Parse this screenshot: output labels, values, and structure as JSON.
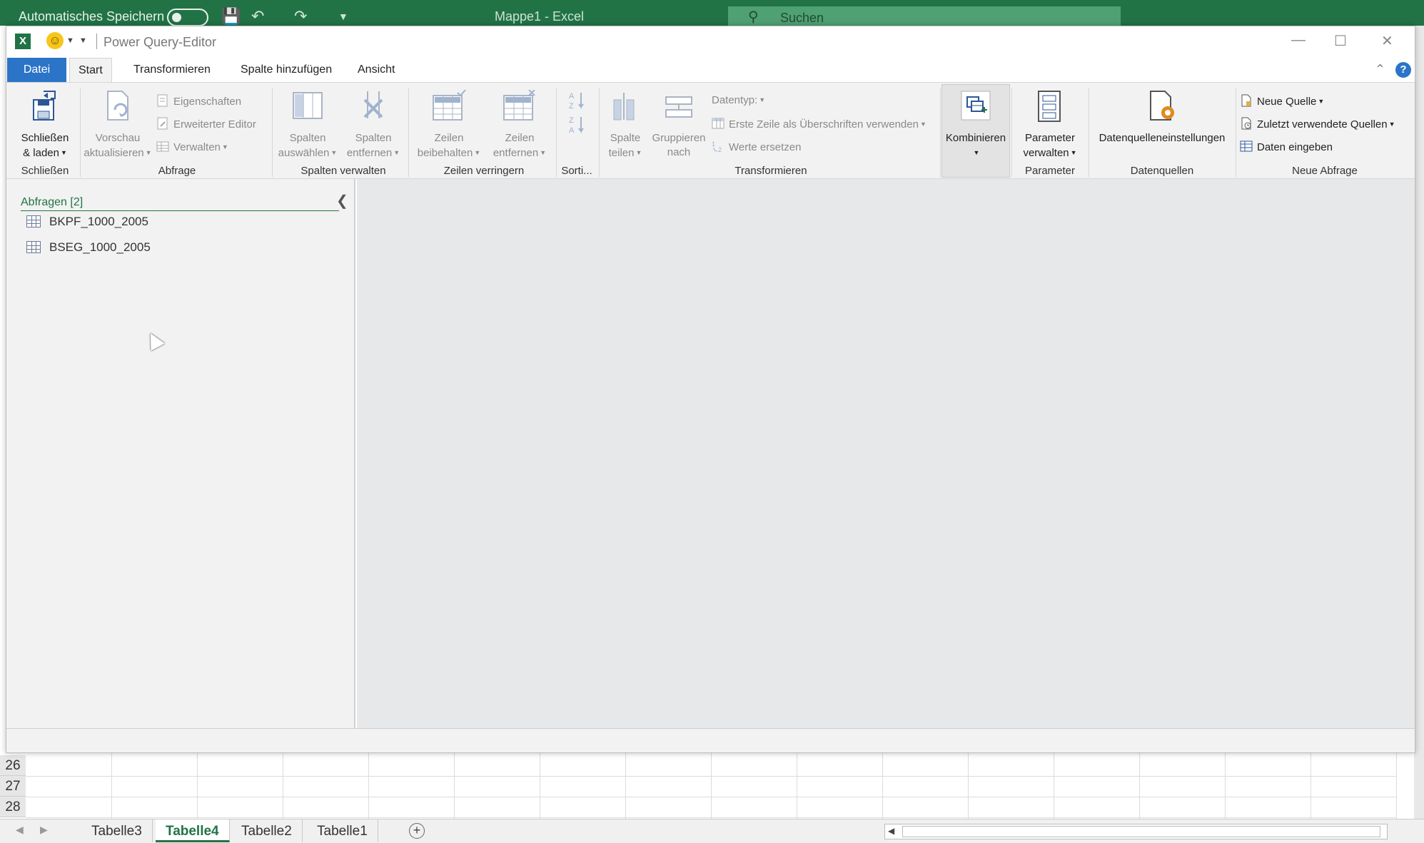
{
  "excel": {
    "autosave_label": "Automatisches Speichern",
    "document_title": "Mappe1  -  Excel",
    "search_placeholder": "Suchen",
    "row_numbers": [
      "26",
      "27",
      "28"
    ],
    "sheets": [
      "Tabelle3",
      "Tabelle4",
      "Tabelle2",
      "Tabelle1"
    ],
    "active_sheet": "Tabelle4"
  },
  "pq": {
    "title": "Power Query-Editor",
    "tabs": [
      "Datei",
      "Start",
      "Transformieren",
      "Spalte hinzufügen",
      "Ansicht"
    ],
    "active_tab": "Start"
  },
  "ribbon": {
    "schliessen": {
      "btn_line1": "Schließen",
      "btn_line2": "& laden",
      "group": "Schließen"
    },
    "abfrage": {
      "vorschau_line1": "Vorschau",
      "vorschau_line2": "aktualisieren",
      "eigenschaften": "Eigenschaften",
      "erweiterter_editor": "Erweiterter Editor",
      "verwalten": "Verwalten",
      "group": "Abfrage"
    },
    "spalten_verwalten": {
      "auswaehlen_line1": "Spalten",
      "auswaehlen_line2": "auswählen",
      "entfernen_line1": "Spalten",
      "entfernen_line2": "entfernen",
      "group": "Spalten verwalten"
    },
    "zeilen_verringern": {
      "beibehalten_line1": "Zeilen",
      "beibehalten_line2": "beibehalten",
      "entfernen_line1": "Zeilen",
      "entfernen_line2": "entfernen",
      "group": "Zeilen verringern"
    },
    "sortieren": {
      "group": "Sorti..."
    },
    "transformieren": {
      "teilen_line1": "Spalte",
      "teilen_line2": "teilen",
      "gruppieren_line1": "Gruppieren",
      "gruppieren_line2": "nach",
      "datentyp": "Datentyp:",
      "erste_zeile": "Erste Zeile als Überschriften verwenden",
      "werte_ersetzen": "Werte ersetzen",
      "group": "Transformieren"
    },
    "kombinieren": {
      "label": "Kombinieren"
    },
    "parameter": {
      "btn_line1": "Parameter",
      "btn_line2": "verwalten",
      "group": "Parameter"
    },
    "datenquellen": {
      "btn": "Datenquelleneinstellungen",
      "group": "Datenquellen"
    },
    "neue_abfrage": {
      "neue_quelle": "Neue Quelle",
      "zuletzt": "Zuletzt verwendete Quellen",
      "daten_eingeben": "Daten eingeben",
      "group": "Neue Abfrage"
    }
  },
  "queries": {
    "header": "Abfragen [2]",
    "items": [
      "BKPF_1000_2005",
      "BSEG_1000_2005"
    ]
  },
  "colors": {
    "excel_green": "#217346",
    "file_tab_blue": "#2b74c8",
    "ribbon_bg": "#f2f2f2",
    "main_bg": "#e7e8ea"
  }
}
